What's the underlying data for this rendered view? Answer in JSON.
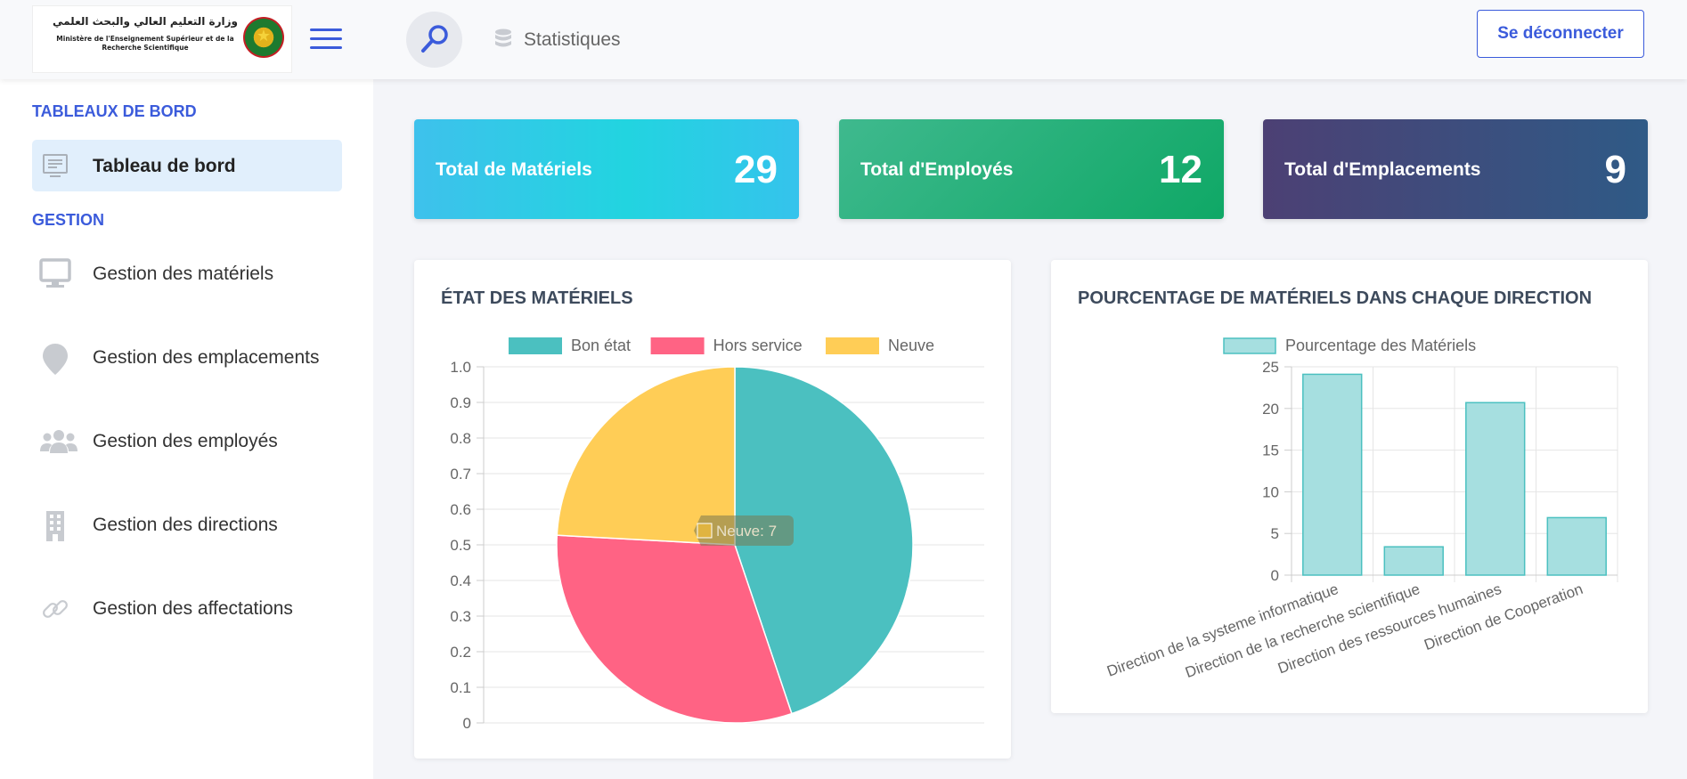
{
  "header": {
    "logo_ar": "وزارة التعليم العالي والبحث العلمي",
    "logo_fr": "Ministère de l'Enseignement Supérieur et de la Recherche Scientifique",
    "breadcrumb": "Statistiques",
    "logout_label": "Se déconnecter"
  },
  "sidebar": {
    "section1": "TABLEAUX DE BORD",
    "dashboard": "Tableau de bord",
    "section2": "GESTION",
    "items": [
      {
        "label": "Gestion des matériels",
        "icon": "monitor-icon"
      },
      {
        "label": "Gestion des emplacements",
        "icon": "map-pin-icon"
      },
      {
        "label": "Gestion des employés",
        "icon": "users-icon"
      },
      {
        "label": "Gestion des directions",
        "icon": "building-icon"
      },
      {
        "label": "Gestion des affectations",
        "icon": "link-icon"
      }
    ]
  },
  "stats": [
    {
      "label": "Total de Matériels",
      "value": "29"
    },
    {
      "label": "Total d'Employés",
      "value": "12"
    },
    {
      "label": "Total d'Emplacements",
      "value": "9"
    }
  ],
  "panels": {
    "state_title": "ÉTAT DES MATÉRIELS",
    "pct_title": "POURCENTAGE DE MATÉRIELS DANS CHAQUE DIRECTION"
  },
  "chart_data": [
    {
      "type": "pie",
      "title": "ÉTAT DES MATÉRIELS",
      "categories": [
        "Bon état",
        "Hors service",
        "Neuve"
      ],
      "values": [
        13,
        9,
        7
      ],
      "colors": [
        "#4bc0c0",
        "#ff6384",
        "#ffcd56"
      ],
      "legend": "top",
      "ylim": [
        0,
        1.0
      ],
      "yticks": [
        "0",
        "0.1",
        "0.2",
        "0.3",
        "0.4",
        "0.5",
        "0.6",
        "0.7",
        "0.8",
        "0.9",
        "1.0"
      ],
      "grid": true,
      "tooltip": "Neuve: 7"
    },
    {
      "type": "bar",
      "title": "POURCENTAGE DE MATÉRIELS DANS CHAQUE DIRECTION",
      "categories": [
        "Direction de la systeme informatique",
        "Direction de la recherche scientifique",
        "Direction des ressources humaines",
        "Direction de Cooperation"
      ],
      "series": [
        {
          "name": "Pourcentage des Matériels",
          "values": [
            24.1,
            3.4,
            20.7,
            6.9
          ]
        }
      ],
      "ylim": [
        0,
        25
      ],
      "yticks": [
        "0",
        "5",
        "10",
        "15",
        "20",
        "25"
      ],
      "grid": true,
      "legend": "top",
      "colors": {
        "fill": "#a6dfe0",
        "stroke": "#4bc0c0"
      }
    }
  ]
}
